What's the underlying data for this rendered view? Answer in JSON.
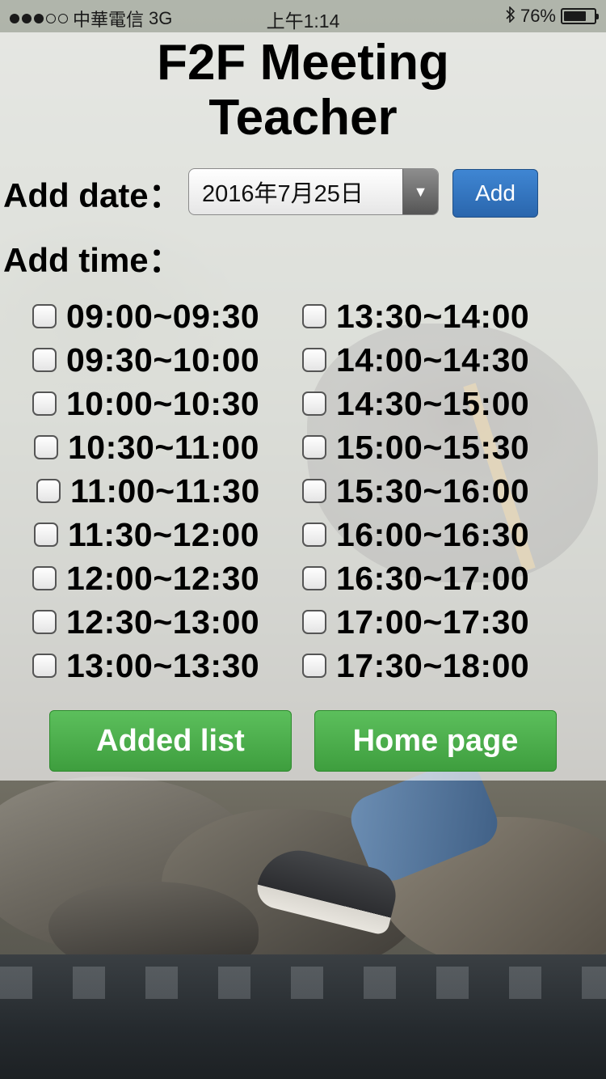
{
  "status_bar": {
    "carrier": "中華電信",
    "network": "3G",
    "time": "上午1:14",
    "battery_percent": "76%",
    "battery_level": 0.76,
    "signal_bars_filled": 3,
    "signal_bars_total": 5
  },
  "page": {
    "title_line1": "F2F Meeting",
    "title_line2": "Teacher"
  },
  "date_row": {
    "label": "Add date：",
    "selected_date": "2016年7月25日",
    "add_button": "Add"
  },
  "time_row": {
    "label": "Add time："
  },
  "slots_left": [
    {
      "label": "09:00~09:30",
      "checked": false
    },
    {
      "label": "09:30~10:00",
      "checked": false
    },
    {
      "label": "10:00~10:30",
      "checked": false
    },
    {
      "label": "10:30~11:00",
      "checked": false
    },
    {
      "label": "11:00~11:30",
      "checked": false
    },
    {
      "label": "11:30~12:00",
      "checked": false
    },
    {
      "label": "12:00~12:30",
      "checked": false
    },
    {
      "label": "12:30~13:00",
      "checked": false
    },
    {
      "label": "13:00~13:30",
      "checked": false
    }
  ],
  "slots_right": [
    {
      "label": "13:30~14:00",
      "checked": false
    },
    {
      "label": "14:00~14:30",
      "checked": false
    },
    {
      "label": "14:30~15:00",
      "checked": false
    },
    {
      "label": "15:00~15:30",
      "checked": false
    },
    {
      "label": "15:30~16:00",
      "checked": false
    },
    {
      "label": "16:00~16:30",
      "checked": false
    },
    {
      "label": "16:30~17:00",
      "checked": false
    },
    {
      "label": "17:00~17:30",
      "checked": false
    },
    {
      "label": "17:30~18:00",
      "checked": false
    }
  ],
  "buttons": {
    "added_list": "Added list",
    "home_page": "Home page"
  },
  "colors": {
    "primary_button": "#2a66ad",
    "success_button": "#4cae4c"
  },
  "icons": {
    "bluetooth": "bluetooth-icon",
    "battery": "battery-icon",
    "signal": "signal-dots-icon",
    "dropdown": "chevron-down-icon"
  }
}
